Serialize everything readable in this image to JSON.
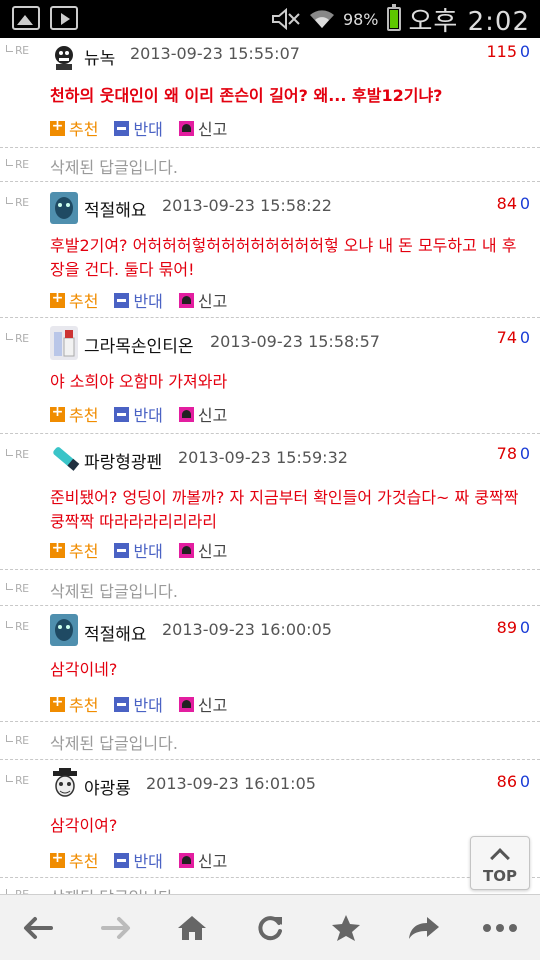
{
  "status_bar": {
    "battery_percent": "98%",
    "time": "오후 2:02",
    "icons": [
      "gallery-icon",
      "play-store-icon",
      "mute-icon",
      "wifi-icon",
      "battery-icon"
    ]
  },
  "action_labels": {
    "recommend": "추천",
    "oppose": "반대",
    "report": "신고"
  },
  "reply_tag": "RE",
  "comments": [
    {
      "nick": "뉴녹",
      "date": "2013-09-23 15:55:07",
      "likes": "115",
      "dislikes": "0",
      "body": "천하의 웃대인이 왜 이리 존슨이 길어? 왜... 후발12기냐?"
    },
    {
      "deleted": "삭제된 답글입니다."
    },
    {
      "nick": "적절해요",
      "date": "2013-09-23 15:58:22",
      "likes": "84",
      "dislikes": "0",
      "body": "후발2기여? 어허허허헣허허허허허허허허헣 오냐 내 돈 모두하고 내 후장을 건다. 둘다 묶어!"
    },
    {
      "nick": "그라목손인티온",
      "date": "2013-09-23 15:58:57",
      "likes": "74",
      "dislikes": "0",
      "body": "야 소희야 오함마 가져와라"
    },
    {
      "nick": "파랑형광펜",
      "date": "2013-09-23 15:59:32",
      "likes": "78",
      "dislikes": "0",
      "body": "준비됐어? 엉딩이 까볼까? 자 지금부터 확인들어 가것습다~ 짜 쿵짝짝 쿵짝짝 따라라라리리라리"
    },
    {
      "deleted": "삭제된 답글입니다."
    },
    {
      "nick": "적절해요",
      "date": "2013-09-23 16:00:05",
      "likes": "89",
      "dislikes": "0",
      "body": "삼각이네?"
    },
    {
      "deleted": "삭제된 답글입니다."
    },
    {
      "nick": "야광룡",
      "date": "2013-09-23 16:01:05",
      "likes": "86",
      "dislikes": "0",
      "body": "삼각이여?"
    },
    {
      "deleted": "삭제된 답글입니다."
    }
  ],
  "top_button": {
    "label": "TOP"
  },
  "bottom_nav": [
    "back-icon",
    "forward-icon",
    "home-icon",
    "refresh-icon",
    "bookmark-star-icon",
    "share-icon",
    "more-icon"
  ],
  "colors": {
    "body_text": "#e3000f",
    "likes": "#dd0000",
    "dislikes": "#1a3cd6",
    "recommend": "#f08c00",
    "oppose": "#4a62c4",
    "report": "#e31ea0"
  }
}
